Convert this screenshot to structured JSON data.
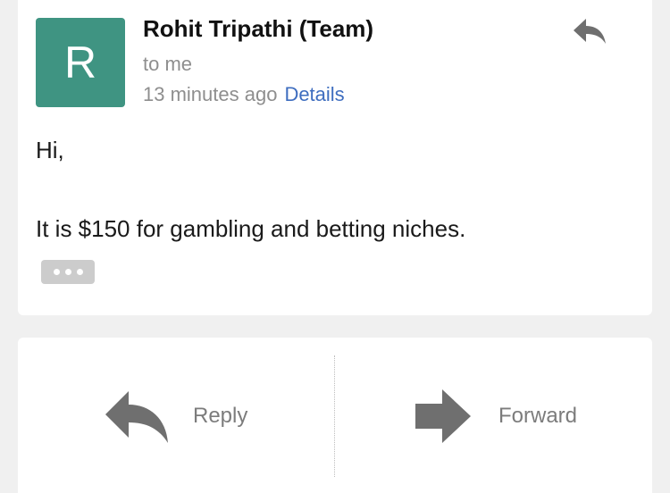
{
  "message": {
    "avatar_letter": "R",
    "avatar_color": "#3f9482",
    "sender": "Rohit Tripathi (Team)",
    "recipient": "to me",
    "time": "13 minutes ago",
    "details_label": "Details",
    "greeting": "Hi,",
    "body": "It is $150 for gambling and betting niches.",
    "header_action_icon": "reply-icon",
    "more_icon": "ellipsis-icon"
  },
  "actions": {
    "reply": {
      "label": "Reply",
      "icon": "reply-icon"
    },
    "forward": {
      "label": "Forward",
      "icon": "forward-icon"
    }
  },
  "colors": {
    "link": "#3e6dbf",
    "background": "#f0f0f0",
    "icon": "#6f6f6f"
  }
}
